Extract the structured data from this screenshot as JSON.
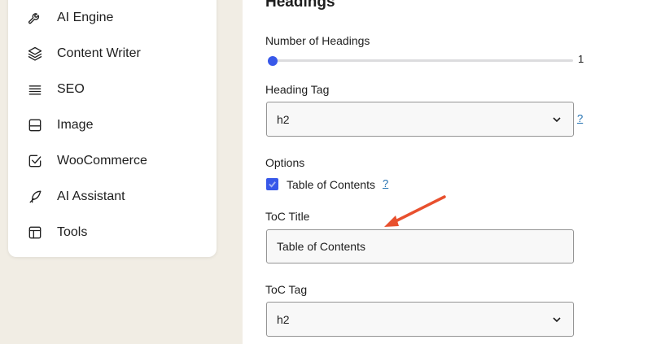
{
  "sidebar": {
    "items": [
      {
        "label": "AI Engine",
        "icon": "wrench-icon"
      },
      {
        "label": "Content Writer",
        "icon": "layers-icon"
      },
      {
        "label": "SEO",
        "icon": "lines-icon"
      },
      {
        "label": "Image",
        "icon": "image-icon"
      },
      {
        "label": "WooCommerce",
        "icon": "checkbox-icon"
      },
      {
        "label": "AI Assistant",
        "icon": "feather-icon"
      },
      {
        "label": "Tools",
        "icon": "layout-icon"
      }
    ]
  },
  "main": {
    "section_title": "Headings",
    "num_headings": {
      "label": "Number of Headings",
      "value": "1"
    },
    "heading_tag": {
      "label": "Heading Tag",
      "value": "h2",
      "help": "?"
    },
    "options": {
      "label": "Options",
      "toc_checkbox_label": "Table of Contents",
      "help": "?",
      "checked": true
    },
    "toc_title": {
      "label": "ToC Title",
      "value": "Table of Contents"
    },
    "toc_tag": {
      "label": "ToC Tag",
      "value": "h2"
    }
  },
  "colors": {
    "accent": "#3858e9",
    "annotation_arrow": "#e8502e",
    "background": "#f1ede4"
  }
}
